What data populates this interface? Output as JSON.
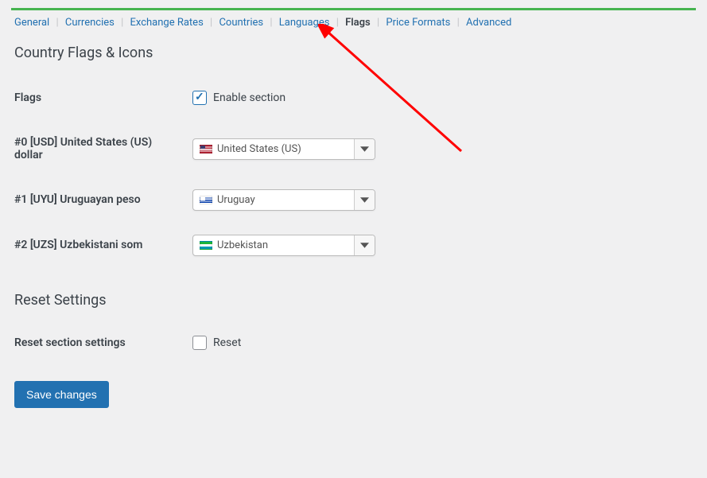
{
  "tabs": {
    "general": "General",
    "currencies": "Currencies",
    "exchange_rates": "Exchange Rates",
    "countries": "Countries",
    "languages": "Languages",
    "flags": "Flags",
    "price_formats": "Price Formats",
    "advanced": "Advanced"
  },
  "sections": {
    "heading": "Country Flags & Icons",
    "flags_label": "Flags",
    "enable_label": "Enable section",
    "enable_checked": true,
    "currencies": [
      {
        "label": "#0 [USD] United States (US) dollar",
        "country": "United States (US)",
        "flag": "us"
      },
      {
        "label": "#1 [UYU] Uruguayan peso",
        "country": "Uruguay",
        "flag": "uy"
      },
      {
        "label": "#2 [UZS] Uzbekistani som",
        "country": "Uzbekistan",
        "flag": "uz"
      }
    ],
    "reset_heading": "Reset Settings",
    "reset_label": "Reset section settings",
    "reset_checkbox_label": "Reset",
    "reset_checked": false
  },
  "buttons": {
    "save": "Save changes"
  }
}
